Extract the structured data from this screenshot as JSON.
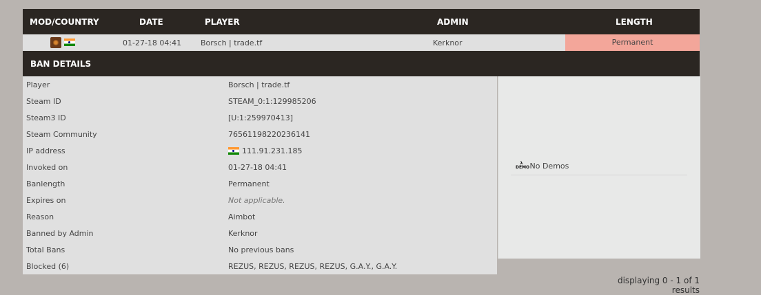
{
  "header": {
    "mod_country": "MOD/COUNTRY",
    "date": "DATE",
    "player": "PLAYER",
    "admin": "ADMIN",
    "length": "LENGTH"
  },
  "ban": {
    "mod_icon": "tf2-game-icon",
    "country_flag": "india-flag-icon",
    "date": "01-27-18 04:41",
    "player": "Borsch | trade.tf",
    "admin": "Kerknor",
    "length": "Permanent",
    "length_color": "#f3a69a"
  },
  "details": {
    "title": "BAN DETAILS",
    "rows": [
      {
        "key": "Player",
        "value": "Borsch | trade.tf"
      },
      {
        "key": "Steam ID",
        "value": "STEAM_0:1:129985206"
      },
      {
        "key": "Steam3 ID",
        "value": "[U:1:259970413]"
      },
      {
        "key": "Steam Community",
        "value": "76561198220236141"
      },
      {
        "key": "IP address",
        "value": "111.91.231.185"
      },
      {
        "key": "Invoked on",
        "value": "01-27-18 04:41"
      },
      {
        "key": "Banlength",
        "value": "Permanent"
      },
      {
        "key": "Expires on",
        "value": "Not applicable."
      },
      {
        "key": "Reason",
        "value": "Aimbot"
      },
      {
        "key": "Banned by Admin",
        "value": "Kerknor"
      },
      {
        "key": "Total Bans",
        "value": "No previous bans"
      },
      {
        "key": "Blocked (6)",
        "value": "REZUS, REZUS, REZUS, REZUS, G.A.Y., G.A.Y."
      }
    ]
  },
  "demos": {
    "icon": "demo-icon",
    "icon_text": "DEMO",
    "label": "No Demos"
  },
  "footer": {
    "results": "displaying 0 - 1 of 1 results"
  },
  "colors": {
    "header_bg": "#2b2622",
    "page_bg": "#b9b4b0",
    "row_bg": "#e0e0e0",
    "permanent_bg": "#f3a69a"
  }
}
